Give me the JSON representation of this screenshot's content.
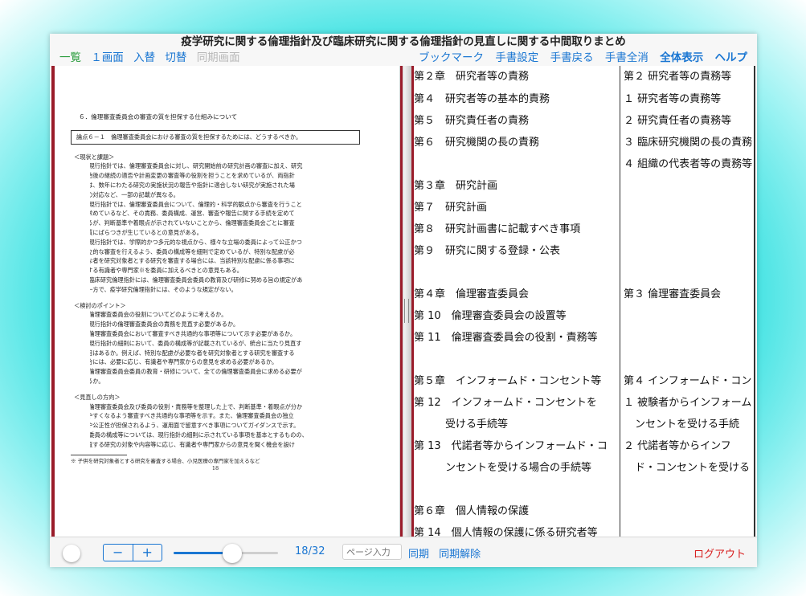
{
  "app": {
    "title": "疫学研究に関する倫理指針及び臨床研究に関する倫理指針の見直しに関する中間取りまとめ"
  },
  "toolbar": {
    "left": [
      {
        "label": "一覧",
        "style": "green"
      },
      {
        "label": "１画面",
        "style": "blue"
      },
      {
        "label": "入替",
        "style": "blue"
      },
      {
        "label": "切替",
        "style": "blue"
      },
      {
        "label": "同期画面",
        "style": "disabled"
      }
    ],
    "right": [
      {
        "label": "ブックマーク",
        "style": "blue"
      },
      {
        "label": "手書設定",
        "style": "blue"
      },
      {
        "label": "手書戻る",
        "style": "blue"
      },
      {
        "label": "手書全消",
        "style": "blue"
      },
      {
        "label": "全体表示",
        "style": "bold"
      },
      {
        "label": "ヘルプ",
        "style": "bold"
      }
    ]
  },
  "left_doc": {
    "heading": "６．倫理審査委員会の審査の質を担保する仕組みについて",
    "box": "論点６－１　倫理審査委員会における審査の質を担保するためには、どうするべきか。",
    "sec1_title": "＜現状と課題＞",
    "sec1_items": [
      [
        "① 現行指針では、倫理審査委員会に対し、研究開始前の研究計画の審査に加え、研究",
        "開始後の継続の適否や計画変更の審査等の役割を担うことを求めているが、両指針",
        "では、数年にわたる研究の実施状況の報告や指針に適合しない研究が実施された場",
        "合の対応など、一部の記載が異なる。"
      ],
      [
        "② 現行指針では、倫理審査委員会について、倫理的・科学的観点から審査を行うこと",
        "を求めているなど、その責務、委員構成、運営、審査や報告に関する手続を定めて",
        "いるが、判断基準や着眼点が示されていないことから、倫理審査委員会ごとに審査",
        "の質にばらつきが生じているとの意見がある。"
      ],
      [
        "③ 現行指針では、学際的かつ多元的な視点から、様々な立場の委員によって公正かつ",
        "中立的な審査を行えるよう、委員の構成等を細則で定めているが、特別な配慮が必",
        "要な者を研究対象者とする研究を審査する場合には、当該特別な配慮に係る事項に",
        "関する有識者や専門家※を委員に加えるべきとの意見もある。"
      ],
      [
        "④ 臨床研究倫理指針には、倫理審査委員会委員の教育及び研修に努める旨の規定があ",
        "る一方で、疫学研究倫理指針には、そのような規定がない。"
      ]
    ],
    "sec2_title": "＜検討のポイント＞",
    "sec2_items": [
      [
        "① 倫理審査委員会の役割についてどのように考えるか。"
      ],
      [
        "② 現行指針の倫理審査委員会の責務を見直す必要があるか。"
      ],
      [
        "③ 倫理審査委員会において審査すべき共通的な事項等について示す必要があるか。"
      ],
      [
        "④ 現行指針の細則において、委員の構成等が記載されているが、統合に当たり見直す",
        "項目はあるか。例えば、特別な配慮が必要な者を研究対象者とする研究を審査する",
        "場合には、必要に応じ、有識者や専門家からの意見を求める必要があるか。"
      ],
      [
        "⑤ 倫理審査委員会委員の教育・研修について、全ての倫理審査委員会に求める必要が",
        "あるか。"
      ]
    ],
    "sec3_title": "＜見直しの方向＞",
    "sec3_items": [
      [
        "① 倫理審査委員会及び委員の役割・責務等を整理した上で、判断基準・着眼点が分か",
        "りやすくなるよう審査すべき共通的な事項等を示す。また、倫理審査委員会の独立",
        "性や公正性が担保されるよう、運用面で留意すべき事項についてガイダンスで示す。"
      ],
      [
        "② 委員の構成等については、現行指針の細則に示されている事項を基本とするものの、",
        "審査する研究の対象や内容等に応じ、有識者や専門家からの意見を聞く機会を設け"
      ]
    ],
    "footnote": "※ 子供を研究対象者とする研究を審査する場合、小児医療の専門家を加えるなど",
    "page_number": "18"
  },
  "right_doc": {
    "col_a": [
      "第２章　研究者等の責務",
      "第４　研究者等の基本的責務",
      "第５　研究責任者の責務",
      "第６　研究機関の長の責務",
      "",
      "第３章　研究計画",
      "第７　研究計画",
      "第８　研究計画書に記載すべき事項",
      "第９　研究に関する登録・公表",
      "",
      "第４章　倫理審査委員会",
      "第 10　倫理審査委員会の設置等",
      "第 11　倫理審査委員会の役割・責務等",
      "",
      "第５章　インフォームド・コンセント等",
      "第 12　インフォームド・コンセントを",
      "　　　受ける手続等",
      "第 13　代諾者等からインフォームド・コ",
      "　　　ンセントを受ける場合の手続等",
      "",
      "第６章　個人情報の保護",
      "第 14　個人情報の保護に係る研究者等"
    ],
    "col_b": [
      "第２ 研究者等の責務等",
      "１ 研究者等の責務等",
      "２ 研究責任者の責務等",
      "３ 臨床研究機関の長の責務",
      "４ 組織の代表者等の責務等",
      "第３ 倫理審査委員会",
      "第４ インフォームド・コン",
      "１ 被験者からインフォーム",
      "ンセントを受ける手続",
      "２ 代諾者等からインフ",
      "ド・コンセントを受ける"
    ]
  },
  "bottom": {
    "stepper_minus": "−",
    "stepper_plus": "+",
    "slider_fraction": 0.56,
    "page_count": "18/32",
    "page_input_placeholder": "ページ入力",
    "sync_label": "同期",
    "sync_cancel_label": "同期解除",
    "logout_label": "ログアウト"
  }
}
